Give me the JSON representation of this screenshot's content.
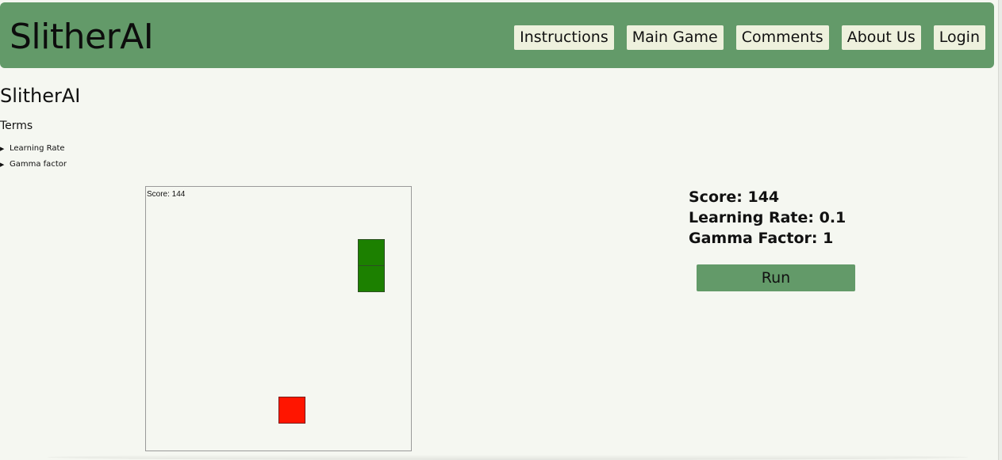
{
  "header": {
    "brand": "SlitherAI",
    "nav": [
      "Instructions",
      "Main Game",
      "Comments",
      "About Us",
      "Login"
    ]
  },
  "main": {
    "title": "SlitherAI",
    "terms_label": "Terms",
    "terms": [
      "Learning Rate",
      "Gamma factor"
    ]
  },
  "game": {
    "score_overlay": "Score: 144"
  },
  "stats": {
    "score": "Score: 144",
    "learning_rate": "Learning Rate: 0.1",
    "gamma_factor": "Gamma Factor: 1",
    "run_label": "Run"
  },
  "colors": {
    "header_bg": "#639a69",
    "nav_item_bg": "#eef1dd",
    "page_bg": "#f5f7f1",
    "snake": "#1c8000",
    "food": "#ff1500"
  }
}
